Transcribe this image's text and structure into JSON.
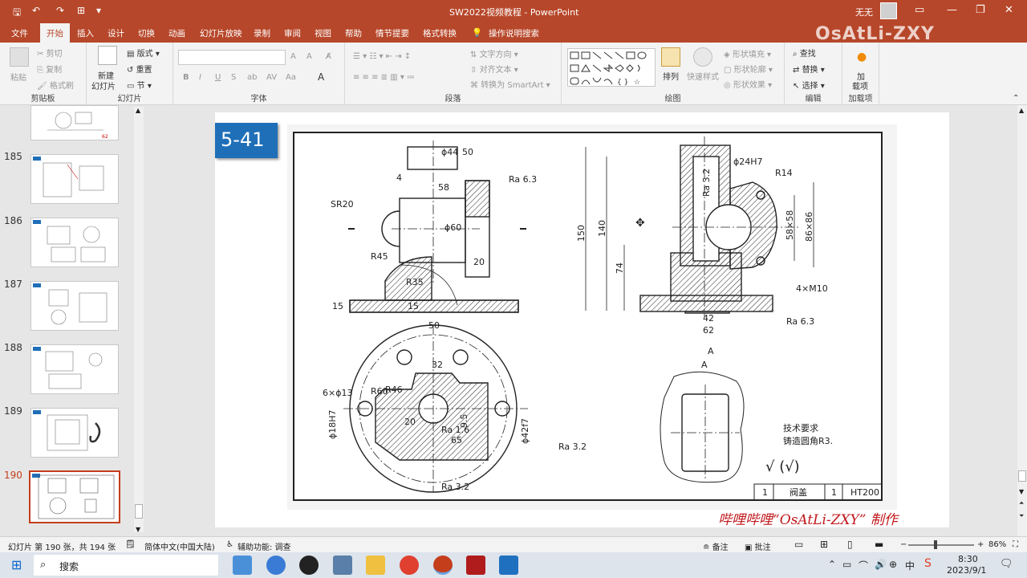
{
  "window": {
    "title": "SW2022视频教程 - PowerPoint",
    "user": "无无",
    "brand_color": "#b7472a"
  },
  "tabs": [
    "文件",
    "开始",
    "插入",
    "设计",
    "切换",
    "动画",
    "幻灯片放映",
    "录制",
    "审阅",
    "视图",
    "帮助",
    "情节提要",
    "格式转换",
    "操作说明搜索"
  ],
  "watermark": "OsAtLi-ZXY",
  "ribbon": {
    "clipboard": {
      "paste": "粘贴",
      "cut": "剪切",
      "copy": "复制",
      "format_painter": "格式刷",
      "label": "剪贴板"
    },
    "slides": {
      "new": "新建",
      "new2": "幻灯片",
      "layout": "版式",
      "reset": "重置",
      "section": "节",
      "label": "幻灯片"
    },
    "font": {
      "label": "字体",
      "bold": "B",
      "italic": "I",
      "underline": "U",
      "strike": "S",
      "size_up": "A",
      "size_down": "A"
    },
    "paragraph": {
      "text_dir": "文字方向",
      "align_text": "对齐文本",
      "smartart": "转换为 SmartArt",
      "label": "段落"
    },
    "drawing": {
      "arrange": "排列",
      "quick_styles": "快速样式",
      "fill": "形状填充",
      "outline": "形状轮廓",
      "effect": "形状效果",
      "label": "绘图"
    },
    "editing": {
      "find": "查找",
      "replace": "替换",
      "select": "选择",
      "label": "编辑"
    },
    "addins": {
      "load": "加",
      "load2": "载项",
      "label": "加载项"
    }
  },
  "slide_thumbs": [
    {
      "num": "",
      "active": false
    },
    {
      "num": "185",
      "active": false
    },
    {
      "num": "186",
      "active": false
    },
    {
      "num": "187",
      "active": false
    },
    {
      "num": "188",
      "active": false
    },
    {
      "num": "189",
      "active": false
    },
    {
      "num": "190",
      "active": true
    }
  ],
  "slide": {
    "badge": "5-41",
    "credit": "哔哩哔哩“OsAtLi-ZXY” 制作",
    "drawing_labels": {
      "d44": "ϕ44",
      "d50": "50",
      "d58": "58",
      "d4": "4",
      "sr20": "SR20",
      "d60": "ϕ60",
      "d20": "20",
      "r45": "R45",
      "r35": "R35",
      "d15a": "15",
      "d15b": "15",
      "ra63a": "Ra 6.3",
      "d24h7": "ϕ24H7",
      "r14": "R14",
      "ra32a": "Ra 3.2",
      "d150": "150",
      "d140": "140",
      "d74": "74",
      "d58x58": "58×58",
      "d86x86": "86×86",
      "m10": "4×M10",
      "d42": "42",
      "d62": "62",
      "ra63b": "Ra 6.3",
      "arrowA": "A",
      "viewA": "A",
      "b50": "50",
      "b32": "32",
      "hole6": "6×ϕ13",
      "r60": "R60",
      "r46": "R46",
      "d18h7": "ϕ18H7",
      "b20": "20",
      "b95": "9.5",
      "ra16": "Ra 1.6",
      "b65": "65",
      "d42f7": "ϕ42f7",
      "ra32b": "Ra 3.2",
      "ra32c": "Ra 3.2",
      "tech1": "技术要求",
      "tech2": "铸造圆角R3.",
      "tb1": "1",
      "tb2": "阀盖",
      "tb3": "1",
      "tb4": "HT200"
    }
  },
  "status": {
    "slide_info": "幻灯片 第 190 张，共 194 张",
    "lang": "简体中文(中国大陆)",
    "access": "辅助功能: 调查",
    "notes": "备注",
    "comments": "批注",
    "zoom": "86%"
  },
  "taskbar": {
    "search": "搜索",
    "time": "8:30",
    "date": "2023/9/1",
    "ime": "中"
  }
}
